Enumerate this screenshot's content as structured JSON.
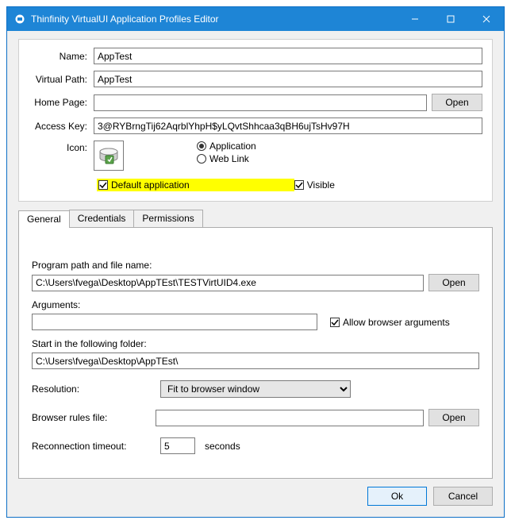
{
  "window": {
    "title": "Thinfinity VirtualUI Application Profiles Editor"
  },
  "form": {
    "name_label": "Name:",
    "name_value": "AppTest",
    "vpath_label": "Virtual Path:",
    "vpath_value": "AppTest",
    "home_label": "Home Page:",
    "home_value": "",
    "open_label": "Open",
    "akey_label": "Access Key:",
    "akey_value": "3@RYBrngTij62AqrblYhpH$yLQvtShhcaa3qBH6ujTsHv97H",
    "icon_label": "Icon:",
    "radio_application": "Application",
    "radio_weblink": "Web Link",
    "default_app_label": "Default application",
    "visible_label": "Visible"
  },
  "tabs": {
    "general": "General",
    "credentials": "Credentials",
    "permissions": "Permissions"
  },
  "general": {
    "program_label": "Program path and file name:",
    "program_value": "C:\\Users\\fvega\\Desktop\\AppTEst\\TESTVirtUID4.exe",
    "open_label": "Open",
    "arguments_label": "Arguments:",
    "arguments_value": "",
    "allow_browser_args": "Allow browser arguments",
    "start_folder_label": "Start in the following folder:",
    "start_folder_value": "C:\\Users\\fvega\\Desktop\\AppTEst\\",
    "resolution_label": "Resolution:",
    "resolution_value": "Fit to browser window",
    "browser_rules_label": "Browser rules file:",
    "browser_rules_value": "",
    "reconnect_label": "Reconnection timeout:",
    "reconnect_value": "5",
    "reconnect_unit": "seconds"
  },
  "buttons": {
    "ok": "Ok",
    "cancel": "Cancel"
  }
}
